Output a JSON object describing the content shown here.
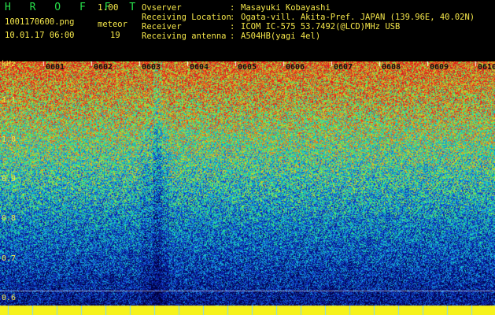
{
  "app": {
    "logo": "H R O F F T",
    "version": "1.00"
  },
  "file": {
    "name": "1001170600.png",
    "datetime": "10.01.17 06:00"
  },
  "detector": {
    "label": "meteor",
    "count": "19"
  },
  "info": [
    {
      "label": "Ovserver",
      "sep": ":",
      "value": "Masayuki Kobayashi"
    },
    {
      "label": "Receiving Location",
      "sep": ":",
      "value": "Ogata-vill. Akita-Pref. JAPAN (139.96E, 40.02N)"
    },
    {
      "label": "Receiver",
      "sep": ":",
      "value": "ICOM IC-575 53.7492(@LCD)MHz USB"
    },
    {
      "label": "Receiving antenna",
      "sep": ":",
      "value": "A504HB(yagi 4el)"
    }
  ],
  "spectrogram": {
    "y_unit": "kHz",
    "y_ticks": [
      "1.1",
      "1.0",
      "0.9",
      "0.8",
      "0.7",
      "0.6"
    ],
    "x_ticks": [
      "0601",
      "0602",
      "0603",
      "0604",
      "0605",
      "0606",
      "0607",
      "0608",
      "0609",
      "0610"
    ],
    "colors": {
      "low": "#0a1a9c",
      "mid": "#19e0c8",
      "high": "#e03a1e",
      "floor": "#f6f21c"
    }
  }
}
